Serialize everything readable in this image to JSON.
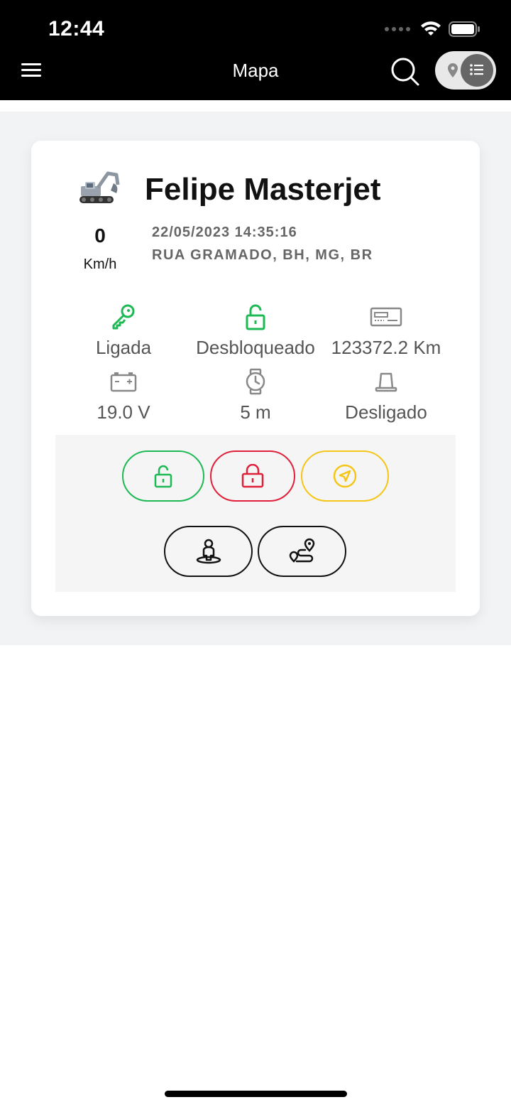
{
  "status_bar": {
    "time": "12:44"
  },
  "header": {
    "title": "Mapa",
    "menu_icon": "hamburger-menu-icon",
    "search_icon": "search-icon",
    "view_toggle": {
      "options": [
        "map-pin-icon",
        "list-icon"
      ],
      "selected": "list"
    }
  },
  "vehicle": {
    "name": "Felipe Masterjet",
    "icon": "excavator-icon",
    "speed": "0",
    "speed_unit": "Km/h",
    "datetime": "22/05/2023 14:35:16",
    "address": "RUA GRAMADO, BH, MG, BR"
  },
  "stats": [
    {
      "icon": "key-icon",
      "label": "Ligada",
      "color": "#1db954"
    },
    {
      "icon": "unlocked-icon",
      "label": "Desbloqueado",
      "color": "#1db954"
    },
    {
      "icon": "odometer-icon",
      "label": "123372.2 Km",
      "color": "#888888"
    },
    {
      "icon": "battery-icon",
      "label": "19.0 V",
      "color": "#888888"
    },
    {
      "icon": "timer-icon",
      "label": "5 m",
      "color": "#888888"
    },
    {
      "icon": "siren-icon",
      "label": "Desligado",
      "color": "#888888"
    }
  ],
  "actions": [
    {
      "icon": "unlock-icon",
      "color": "#1db954"
    },
    {
      "icon": "lock-icon",
      "color": "#e0203a"
    },
    {
      "icon": "navigate-icon",
      "color": "#f5c518"
    },
    {
      "icon": "person-location-icon",
      "color": "#111111"
    },
    {
      "icon": "route-icon",
      "color": "#111111"
    }
  ]
}
